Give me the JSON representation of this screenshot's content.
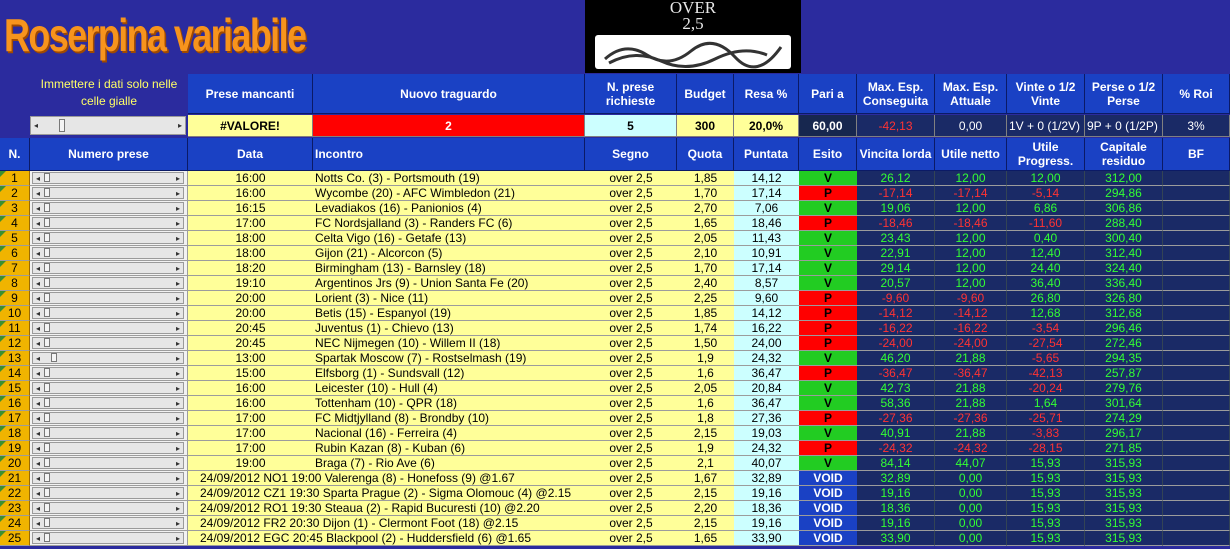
{
  "title": "Roserpina variabile",
  "logo_text": "OVER\n2,5",
  "hint": "Immettere i dati solo nelle celle gialle",
  "top_headers": {
    "prese_mancanti": "Prese mancanti",
    "nuovo_traguardo": "Nuovo traguardo",
    "n_prese": "N. prese richieste",
    "budget": "Budget",
    "resa": "Resa %",
    "pari_a": "Pari a",
    "max_esp_cons": "Max. Esp. Conseguita",
    "max_esp_att": "Max. Esp. Attuale",
    "vinte": "Vinte o 1/2 Vinte",
    "perse": "Perse o 1/2 Perse",
    "roi": "% Roi"
  },
  "top_values": {
    "prese_mancanti": "#VALORE!",
    "nuovo_traguardo": "2",
    "n_prese": "5",
    "budget": "300",
    "resa": "20,0%",
    "pari_a": "60,00",
    "max_esp_cons": "-42,13",
    "max_esp_att": "0,00",
    "vinte": "1V + 0 (1/2V)",
    "perse": "9P + 0 (1/2P)",
    "roi": "3%"
  },
  "col_headers": {
    "n": "N.",
    "numero_prese": "Numero prese",
    "data": "Data",
    "incontro": "Incontro",
    "segno": "Segno",
    "quota": "Quota",
    "puntata": "Puntata",
    "esito": "Esito",
    "vincita": "Vincita lorda",
    "utile": "Utile netto",
    "utile_prog": "Utile Progress.",
    "capitale": "Capitale residuo",
    "bf": "BF"
  },
  "rows": [
    {
      "n": "1",
      "thumb": 0,
      "data": "16:00",
      "incontro": "Notts Co. (3) - Portsmouth (19)",
      "segno": "over 2,5",
      "quota": "1,85",
      "puntata": "14,12",
      "esito": "V",
      "vincita": "26,12",
      "utile": "12,00",
      "prog": "12,00",
      "cap": "312,00"
    },
    {
      "n": "2",
      "thumb": 0,
      "data": "16:00",
      "incontro": "Wycombe (20) - AFC Wimbledon (21)",
      "segno": "over 2,5",
      "quota": "1,70",
      "puntata": "17,14",
      "esito": "P",
      "vincita": "-17,14",
      "utile": "-17,14",
      "prog": "-5,14",
      "cap": "294,86"
    },
    {
      "n": "3",
      "thumb": 0,
      "data": "16:15",
      "incontro": "Levadiakos (16) - Panionios (4)",
      "segno": "over 2,5",
      "quota": "2,70",
      "puntata": "7,06",
      "esito": "V",
      "vincita": "19,06",
      "utile": "12,00",
      "prog": "6,86",
      "cap": "306,86"
    },
    {
      "n": "4",
      "thumb": 0,
      "data": "17:00",
      "incontro": "FC Nordsjalland (3) - Randers FC (6)",
      "segno": "over 2,5",
      "quota": "1,65",
      "puntata": "18,46",
      "esito": "P",
      "vincita": "-18,46",
      "utile": "-18,46",
      "prog": "-11,60",
      "cap": "288,40"
    },
    {
      "n": "5",
      "thumb": 0,
      "data": "18:00",
      "incontro": "Celta Vigo (16) - Getafe (13)",
      "segno": "over 2,5",
      "quota": "2,05",
      "puntata": "11,43",
      "esito": "V",
      "vincita": "23,43",
      "utile": "12,00",
      "prog": "0,40",
      "cap": "300,40"
    },
    {
      "n": "6",
      "thumb": 0,
      "data": "18:00",
      "incontro": "Gijon (21) - Alcorcon (5)",
      "segno": "over 2,5",
      "quota": "2,10",
      "puntata": "10,91",
      "esito": "V",
      "vincita": "22,91",
      "utile": "12,00",
      "prog": "12,40",
      "cap": "312,40"
    },
    {
      "n": "7",
      "thumb": 0,
      "data": "18:20",
      "incontro": "Birmingham (13) - Barnsley (18)",
      "segno": "over 2,5",
      "quota": "1,70",
      "puntata": "17,14",
      "esito": "V",
      "vincita": "29,14",
      "utile": "12,00",
      "prog": "24,40",
      "cap": "324,40"
    },
    {
      "n": "8",
      "thumb": 0,
      "data": "19:10",
      "incontro": "Argentinos Jrs (9) - Union Santa Fe (20)",
      "segno": "over 2,5",
      "quota": "2,40",
      "puntata": "8,57",
      "esito": "V",
      "vincita": "20,57",
      "utile": "12,00",
      "prog": "36,40",
      "cap": "336,40"
    },
    {
      "n": "9",
      "thumb": 0,
      "data": "20:00",
      "incontro": "Lorient (3) - Nice (11)",
      "segno": "over 2,5",
      "quota": "2,25",
      "puntata": "9,60",
      "esito": "P",
      "vincita": "-9,60",
      "utile": "-9,60",
      "prog": "26,80",
      "cap": "326,80"
    },
    {
      "n": "10",
      "thumb": 0,
      "data": "20:00",
      "incontro": "Betis (15) - Espanyol (19)",
      "segno": "over 2,5",
      "quota": "1,85",
      "puntata": "14,12",
      "esito": "P",
      "vincita": "-14,12",
      "utile": "-14,12",
      "prog": "12,68",
      "cap": "312,68"
    },
    {
      "n": "11",
      "thumb": 0,
      "data": "20:45",
      "incontro": "Juventus (1) - Chievo (13)",
      "segno": "over 2,5",
      "quota": "1,74",
      "puntata": "16,22",
      "esito": "P",
      "vincita": "-16,22",
      "utile": "-16,22",
      "prog": "-3,54",
      "cap": "296,46"
    },
    {
      "n": "12",
      "thumb": 0,
      "data": "20:45",
      "incontro": "NEC Nijmegen (10) - Willem II (18)",
      "segno": "over 2,5",
      "quota": "1,50",
      "puntata": "24,00",
      "esito": "P",
      "vincita": "-24,00",
      "utile": "-24,00",
      "prog": "-27,54",
      "cap": "272,46"
    },
    {
      "n": "13",
      "thumb": 1,
      "data": "13:00",
      "incontro": "Spartak Moscow (7) - Rostselmash (19)",
      "segno": "over 2,5",
      "quota": "1,9",
      "puntata": "24,32",
      "esito": "V",
      "vincita": "46,20",
      "utile": "21,88",
      "prog": "-5,65",
      "cap": "294,35"
    },
    {
      "n": "14",
      "thumb": 0,
      "data": "15:00",
      "incontro": "Elfsborg (1) - Sundsvall (12)",
      "segno": "over 2,5",
      "quota": "1,6",
      "puntata": "36,47",
      "esito": "P",
      "vincita": "-36,47",
      "utile": "-36,47",
      "prog": "-42,13",
      "cap": "257,87"
    },
    {
      "n": "15",
      "thumb": 0,
      "data": "16:00",
      "incontro": "Leicester (10) - Hull (4)",
      "segno": "over 2,5",
      "quota": "2,05",
      "puntata": "20,84",
      "esito": "V",
      "vincita": "42,73",
      "utile": "21,88",
      "prog": "-20,24",
      "cap": "279,76"
    },
    {
      "n": "16",
      "thumb": 0,
      "data": "16:00",
      "incontro": "Tottenham (10) - QPR (18)",
      "segno": "over 2,5",
      "quota": "1,6",
      "puntata": "36,47",
      "esito": "V",
      "vincita": "58,36",
      "utile": "21,88",
      "prog": "1,64",
      "cap": "301,64"
    },
    {
      "n": "17",
      "thumb": 0,
      "data": "17:00",
      "incontro": "FC Midtjylland (8) - Brondby (10)",
      "segno": "over 2,5",
      "quota": "1,8",
      "puntata": "27,36",
      "esito": "P",
      "vincita": "-27,36",
      "utile": "-27,36",
      "prog": "-25,71",
      "cap": "274,29"
    },
    {
      "n": "18",
      "thumb": 0,
      "data": "17:00",
      "incontro": "Nacional (16) - Ferreira (4)",
      "segno": "over 2,5",
      "quota": "2,15",
      "puntata": "19,03",
      "esito": "V",
      "vincita": "40,91",
      "utile": "21,88",
      "prog": "-3,83",
      "cap": "296,17"
    },
    {
      "n": "19",
      "thumb": 0,
      "data": "17:00",
      "incontro": "Rubin Kazan (8) - Kuban (6)",
      "segno": "over 2,5",
      "quota": "1,9",
      "puntata": "24,32",
      "esito": "P",
      "vincita": "-24,32",
      "utile": "-24,32",
      "prog": "-28,15",
      "cap": "271,85"
    },
    {
      "n": "20",
      "thumb": 0,
      "data": "19:00",
      "incontro": "Braga (7) - Rio Ave (6)",
      "segno": "over 2,5",
      "quota": "2,1",
      "puntata": "40,07",
      "esito": "V",
      "vincita": "84,14",
      "utile": "44,07",
      "prog": "15,93",
      "cap": "315,93"
    },
    {
      "n": "21",
      "thumb": 0,
      "data": "",
      "incontro": "24/09/2012 NO1 19:00 Valerenga (8) - Honefoss (9) @1.67",
      "segno": "over 2,5",
      "quota": "1,67",
      "puntata": "32,89",
      "esito": "VOID",
      "vincita": "32,89",
      "utile": "0,00",
      "prog": "15,93",
      "cap": "315,93"
    },
    {
      "n": "22",
      "thumb": 0,
      "data": "",
      "incontro": "24/09/2012 CZ1 19:30 Sparta Prague (2) - Sigma Olomouc (4) @2.15",
      "segno": "over 2,5",
      "quota": "2,15",
      "puntata": "19,16",
      "esito": "VOID",
      "vincita": "19,16",
      "utile": "0,00",
      "prog": "15,93",
      "cap": "315,93"
    },
    {
      "n": "23",
      "thumb": 0,
      "data": "",
      "incontro": "24/09/2012 RO1 19:30 Steaua (2) - Rapid Bucuresti (10) @2.20",
      "segno": "over 2,5",
      "quota": "2,20",
      "puntata": "18,36",
      "esito": "VOID",
      "vincita": "18,36",
      "utile": "0,00",
      "prog": "15,93",
      "cap": "315,93"
    },
    {
      "n": "24",
      "thumb": 0,
      "data": "",
      "incontro": "24/09/2012 FR2 20:30 Dijon (1) - Clermont Foot (18) @2.15",
      "segno": "over 2,5",
      "quota": "2,15",
      "puntata": "19,16",
      "esito": "VOID",
      "vincita": "19,16",
      "utile": "0,00",
      "prog": "15,93",
      "cap": "315,93"
    },
    {
      "n": "25",
      "thumb": 0,
      "data": "",
      "incontro": "24/09/2012 EGC 20:45 Blackpool (2) - Huddersfield (6) @1.65",
      "segno": "over 2,5",
      "quota": "1,65",
      "puntata": "33,90",
      "esito": "VOID",
      "vincita": "33,90",
      "utile": "0,00",
      "prog": "15,93",
      "cap": "315,93"
    }
  ]
}
